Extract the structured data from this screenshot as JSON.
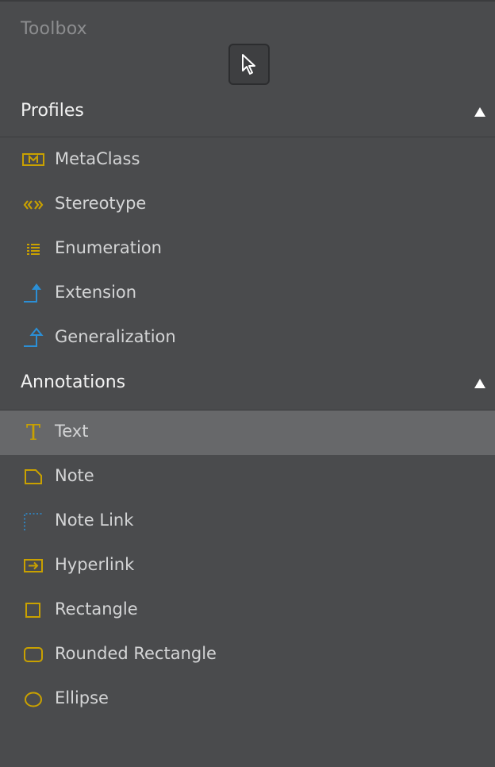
{
  "toolbox": {
    "title": "Toolbox",
    "pointer_tool_icon": "pointer-arrow-icon"
  },
  "sections": [
    {
      "label": "Profiles",
      "collapse_icon": "collapse-triangle-up-icon",
      "items": [
        {
          "label": "MetaClass",
          "icon": "metaclass-icon"
        },
        {
          "label": "Stereotype",
          "icon": "stereotype-icon"
        },
        {
          "label": "Enumeration",
          "icon": "enumeration-icon"
        },
        {
          "label": "Extension",
          "icon": "extension-icon"
        },
        {
          "label": "Generalization",
          "icon": "generalization-icon"
        }
      ]
    },
    {
      "label": "Annotations",
      "collapse_icon": "collapse-triangle-up-icon",
      "items": [
        {
          "label": "Text",
          "icon": "text-icon",
          "selected": true
        },
        {
          "label": "Note",
          "icon": "note-icon"
        },
        {
          "label": "Note Link",
          "icon": "note-link-icon"
        },
        {
          "label": "Hyperlink",
          "icon": "hyperlink-icon"
        },
        {
          "label": "Rectangle",
          "icon": "rectangle-icon"
        },
        {
          "label": "Rounded Rectangle",
          "icon": "rounded-rectangle-icon"
        },
        {
          "label": "Ellipse",
          "icon": "ellipse-icon"
        }
      ]
    }
  ],
  "colors": {
    "background": "#4a4b4d",
    "selected_row": "#67686a",
    "icon_gold": "#c9a100",
    "icon_blue": "#2b8fd6",
    "header_text": "#f2f2f2",
    "item_text": "#d4d5d6",
    "title_text": "#8c8d8f"
  }
}
